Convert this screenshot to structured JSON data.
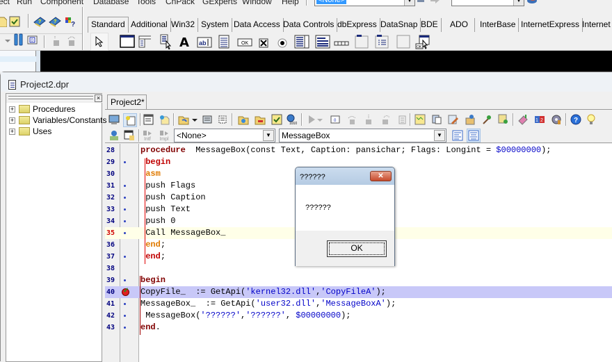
{
  "menubar": {
    "items": [
      "ect",
      "Run",
      "Component",
      "Database",
      "Tools",
      "CnPack",
      "GExperts",
      "Window",
      "Help"
    ]
  },
  "top_toolbar": {
    "component_combo_value": "<None>",
    "second_combo_value": ""
  },
  "palette": {
    "tabs": [
      "Standard",
      "Additional",
      "Win32",
      "System",
      "Data Access",
      "Data Controls",
      "dbExpress",
      "DataSnap",
      "BDE",
      "ADO",
      "InterBase",
      "InternetExpress",
      "Internet"
    ],
    "active_tab": "Standard",
    "components": [
      "pointer",
      "TFrames",
      "TMainMenu",
      "TPopupMenu",
      "TLabel",
      "TEdit",
      "TMemo",
      "TButton",
      "TCheckBox",
      "TRadioButton",
      "TListBox",
      "TComboBox",
      "TScrollBar",
      "TGroupBox",
      "TRadioGroup",
      "TPanel",
      "TActionList"
    ]
  },
  "project_window": {
    "title": "Project2.dpr",
    "explorer": {
      "items": [
        {
          "label": "Procedures",
          "expand": "+"
        },
        {
          "label": "Variables/Constants",
          "expand": "+"
        },
        {
          "label": "Uses",
          "expand": "+"
        }
      ],
      "close_glyph": "×"
    },
    "editor": {
      "tab_label": "Project2*",
      "class_combo": "<None>",
      "method_combo": "MessageBox",
      "intf_label": "Intf",
      "impl_label": "Impl",
      "lines": [
        {
          "n": "28",
          "mark": "",
          "segments": [
            [
              "kw",
              "procedure"
            ],
            [
              "",
              "  MessageBox(const Text, Caption: pansichar; Flags: Longint = "
            ],
            [
              "num",
              "$00000000"
            ],
            [
              "",
              ");"
            ]
          ]
        },
        {
          "n": "29",
          "mark": "dot",
          "segments": [
            [
              "",
              " "
            ],
            [
              "kw-red",
              "begin"
            ]
          ]
        },
        {
          "n": "30",
          "mark": "",
          "segments": [
            [
              "",
              " "
            ],
            [
              "kw-or",
              "asm"
            ]
          ]
        },
        {
          "n": "31",
          "mark": "dot",
          "segments": [
            [
              "",
              " push Flags"
            ]
          ]
        },
        {
          "n": "32",
          "mark": "dot",
          "segments": [
            [
              "",
              " push Caption"
            ]
          ]
        },
        {
          "n": "33",
          "mark": "dot",
          "segments": [
            [
              "",
              " push Text"
            ]
          ]
        },
        {
          "n": "34",
          "mark": "dot",
          "segments": [
            [
              "",
              " push 0"
            ]
          ]
        },
        {
          "n": "35",
          "mark": "dot",
          "current": true,
          "segments": [
            [
              "",
              " Call MessageBox_"
            ]
          ]
        },
        {
          "n": "36",
          "mark": "",
          "segments": [
            [
              "",
              " "
            ],
            [
              "kw-or",
              "end"
            ],
            [
              "",
              ";"
            ]
          ]
        },
        {
          "n": "37",
          "mark": "dot",
          "segments": [
            [
              "",
              " "
            ],
            [
              "kw-red",
              "end"
            ],
            [
              "",
              ";"
            ]
          ]
        },
        {
          "n": "38",
          "mark": "",
          "segments": [
            [
              "",
              ""
            ]
          ]
        },
        {
          "n": "39",
          "mark": "dot",
          "segments": [
            [
              "kw",
              "begin"
            ]
          ]
        },
        {
          "n": "40",
          "mark": "breakpoint",
          "breakpoint": true,
          "segments": [
            [
              "",
              "CopyFile_  := GetApi("
            ],
            [
              "str",
              "'kernel32.dll'"
            ],
            [
              "",
              ","
            ],
            [
              "str",
              "'CopyFileA'"
            ],
            [
              "",
              ");"
            ]
          ]
        },
        {
          "n": "41",
          "mark": "dot",
          "segments": [
            [
              "",
              "MessageBox_  := GetApi("
            ],
            [
              "str",
              "'user32.dll'"
            ],
            [
              "",
              ","
            ],
            [
              "str",
              "'MessageBoxA'"
            ],
            [
              "",
              ");"
            ]
          ]
        },
        {
          "n": "42",
          "mark": "dot",
          "segments": [
            [
              "",
              " MessageBox("
            ],
            [
              "str",
              "'??????'"
            ],
            [
              "",
              ","
            ],
            [
              "str",
              "'??????'"
            ],
            [
              "",
              ", "
            ],
            [
              "num",
              "$00000000"
            ],
            [
              "",
              ");"
            ]
          ]
        },
        {
          "n": "43",
          "mark": "dot",
          "segments": [
            [
              "kw",
              "end"
            ],
            [
              "",
              "."
            ]
          ]
        }
      ]
    }
  },
  "message_box": {
    "title": "??????",
    "message": "??????",
    "ok_label": "OK",
    "close_glyph": "✕"
  },
  "colors": {
    "keyword": "#800000",
    "asm_keyword": "#e07a00",
    "string": "#0000c8",
    "breakpoint_line": "#c8c8f8",
    "current_line": "#ffffe8"
  }
}
